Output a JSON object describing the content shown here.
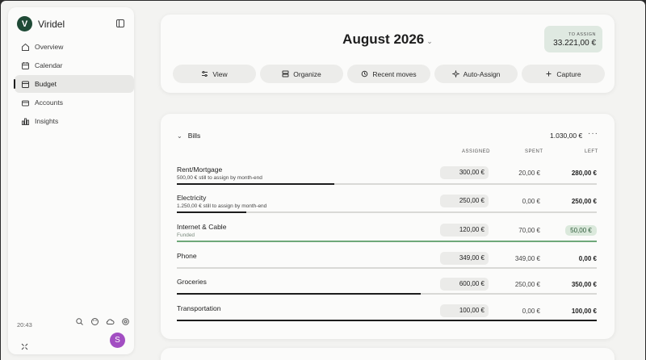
{
  "app": {
    "name": "Viridel",
    "logo_letter": "V"
  },
  "sidebar": {
    "items": [
      {
        "label": "Overview",
        "icon": "home-icon"
      },
      {
        "label": "Calendar",
        "icon": "calendar-icon"
      },
      {
        "label": "Budget",
        "icon": "wallet-icon",
        "active": true
      },
      {
        "label": "Accounts",
        "icon": "bank-icon"
      },
      {
        "label": "Insights",
        "icon": "chart-icon"
      }
    ],
    "time": "20:43",
    "avatar_letter": "S"
  },
  "header": {
    "month": "August 2026",
    "to_assign_label": "TO ASSIGN",
    "to_assign_value": "33.221,00 €",
    "toolbar": [
      {
        "label": "View",
        "icon": "sliders-icon"
      },
      {
        "label": "Organize",
        "icon": "organize-icon"
      },
      {
        "label": "Recent moves",
        "icon": "history-icon"
      },
      {
        "label": "Auto-Assign",
        "icon": "sparkle-icon"
      },
      {
        "label": "Capture",
        "icon": "plus-icon"
      }
    ]
  },
  "bills": {
    "group_name": "Bills",
    "group_total": "1.030,00 €",
    "columns": {
      "assigned": "ASSIGNED",
      "spent": "SPENT",
      "left": "LEFT"
    },
    "rows": [
      {
        "name": "Rent/Mortgage",
        "sub": "500,00 € still to assign by month-end",
        "assigned": "300,00 €",
        "spent": "20,00 €",
        "left": "280,00 €",
        "progress": 0.375,
        "status": "underfunded"
      },
      {
        "name": "Electricity",
        "sub": "1.250,00 € still to assign by month-end",
        "assigned": "250,00 €",
        "spent": "0,00 €",
        "left": "250,00 €",
        "progress": 0.165,
        "status": "underfunded"
      },
      {
        "name": "Internet & Cable",
        "sub": "Funded",
        "assigned": "120,00 €",
        "spent": "70,00 €",
        "left": "50,00 €",
        "progress": 1.0,
        "status": "funded"
      },
      {
        "name": "Phone",
        "sub": "",
        "assigned": "349,00 €",
        "spent": "349,00 €",
        "left": "0,00 €",
        "progress": 0.0,
        "status": "spent"
      },
      {
        "name": "Groceries",
        "sub": "",
        "assigned": "600,00 €",
        "spent": "250,00 €",
        "left": "350,00 €",
        "progress": 0.58,
        "status": "ok"
      },
      {
        "name": "Transportation",
        "sub": "",
        "assigned": "100,00 €",
        "spent": "0,00 €",
        "left": "100,00 €",
        "progress": 1.0,
        "status": "ok"
      }
    ]
  },
  "colors": {
    "brand": "#1f4a36",
    "funded": "#6ea879",
    "avatar": "#a24ec2"
  }
}
